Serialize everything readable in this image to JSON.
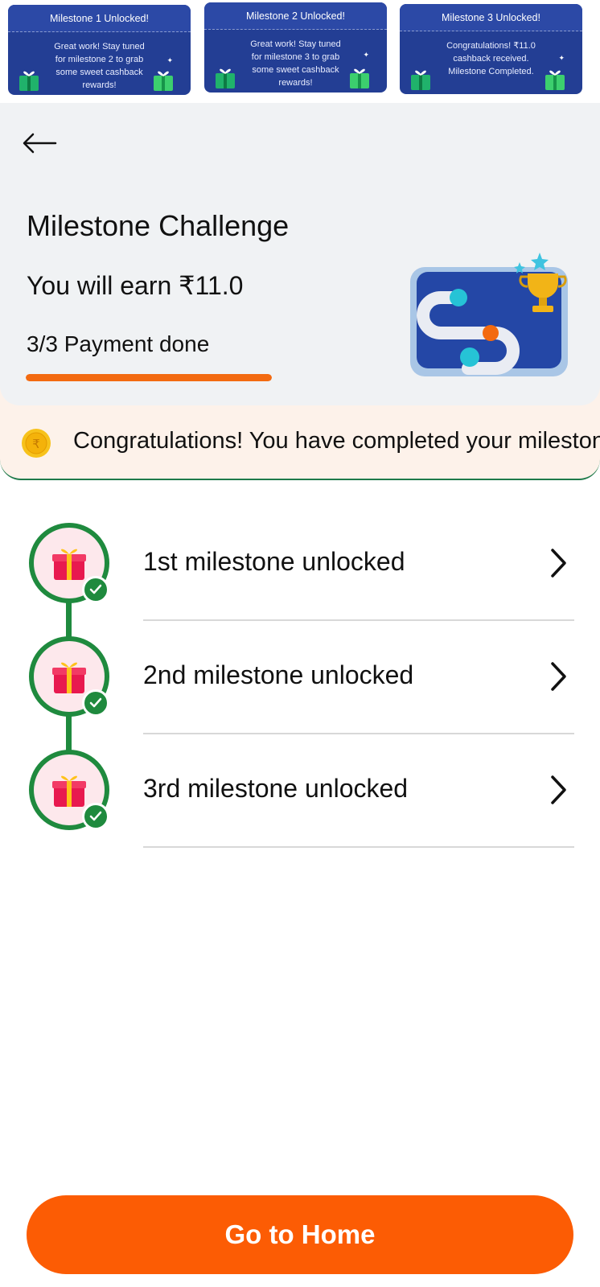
{
  "cards": [
    {
      "title": "Milestone 1 Unlocked!",
      "lines": [
        "Great work! Stay tuned",
        "for milestone 2 to grab",
        "some sweet cashback",
        "rewards!"
      ]
    },
    {
      "title": "Milestone 2 Unlocked!",
      "lines": [
        "Great work! Stay tuned",
        "for milestone 3 to grab",
        "some sweet cashback",
        "rewards!"
      ]
    },
    {
      "title": "Milestone 3 Unlocked!",
      "lines": [
        "Congratulations! ₹11.0",
        "cashback received.",
        "Milestone Completed."
      ]
    }
  ],
  "header": {
    "title": "Milestone Challenge",
    "earn": "You will earn ₹11.0",
    "payment": "3/3 Payment done",
    "progress_fraction": 1.0
  },
  "banner": {
    "text": "Congratulations! You have completed your milestone challenge"
  },
  "milestones": [
    {
      "label": "1st milestone unlocked"
    },
    {
      "label": "2nd milestone unlocked"
    },
    {
      "label": "3rd milestone unlocked"
    }
  ],
  "footer": {
    "home_label": "Go to Home"
  },
  "colors": {
    "accent_orange": "#fc5c04",
    "success_green": "#1f8a3e",
    "card_blue": "#233e94"
  },
  "icons": [
    "back-arrow-icon",
    "gift-icon",
    "check-icon",
    "chevron-right-icon",
    "rupee-coin-icon",
    "trophy-icon"
  ]
}
